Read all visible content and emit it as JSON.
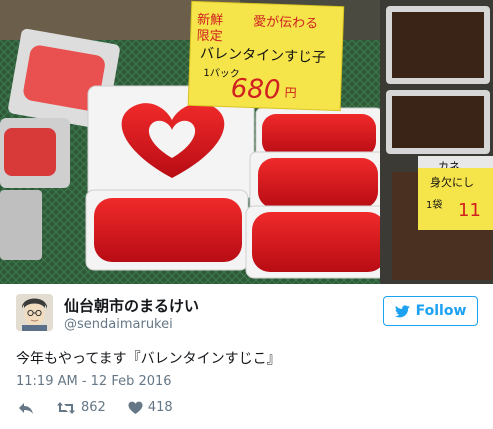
{
  "photo": {
    "sign_main": {
      "line1": "新鮮",
      "line2": "限定",
      "line3": "愛が伝わる",
      "line4": "バレンタインすじ子",
      "line5": "1パック",
      "price": "680",
      "unit": "円"
    },
    "sign_side": {
      "line1": "カネ",
      "line2": "身欠にし",
      "line3": "1袋",
      "price": "11"
    }
  },
  "tweet": {
    "display_name": "仙台朝市のまるけい",
    "handle": "@sendaimarukei",
    "follow_label": "Follow",
    "text": "今年もやってます『バレンタインすじこ』",
    "timestamp": "11:19 AM - 12 Feb 2016",
    "retweet_count": "862",
    "like_count": "418"
  },
  "colors": {
    "twitter_blue": "#1da1f2",
    "muted_gray": "#657786",
    "roe_red": "#d9141c"
  }
}
